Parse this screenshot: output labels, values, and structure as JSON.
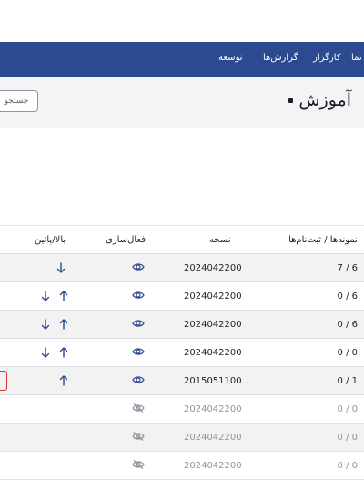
{
  "navbar": {
    "items": [
      {
        "label": "توسعه"
      },
      {
        "label": "گزارش‌ها"
      },
      {
        "label": "کارگزار"
      },
      {
        "label": "تما"
      }
    ],
    "background": "#2c4a8f"
  },
  "header": {
    "title": "آموزش",
    "search_label": "جستجو"
  },
  "table": {
    "headers": {
      "ratio": "نمونه‌ها / ثبت‌نام‌ها",
      "version": "نسخه",
      "enable": "فعال‌سازی",
      "order": "بالا/پائین"
    },
    "rows": [
      {
        "ratio": "7 / 6",
        "version": "2024042200",
        "visible": true,
        "up": false,
        "down": true,
        "edit": false
      },
      {
        "ratio": "0 / 6",
        "version": "2024042200",
        "visible": true,
        "up": true,
        "down": true,
        "edit": false
      },
      {
        "ratio": "0 / 6",
        "version": "2024042200",
        "visible": true,
        "up": true,
        "down": true,
        "edit": false
      },
      {
        "ratio": "0 / 0",
        "version": "2024042200",
        "visible": true,
        "up": true,
        "down": true,
        "edit": false
      },
      {
        "ratio": "0 / 1",
        "version": "2015051100",
        "visible": true,
        "up": true,
        "down": false,
        "edit": true
      },
      {
        "ratio": "0 / 0",
        "version": "2024042200",
        "visible": false,
        "up": false,
        "down": false,
        "edit": false
      },
      {
        "ratio": "0 / 0",
        "version": "2024042200",
        "visible": false,
        "up": false,
        "down": false,
        "edit": false
      },
      {
        "ratio": "0 / 0",
        "version": "2024042200",
        "visible": false,
        "up": false,
        "down": false,
        "edit": false
      }
    ]
  },
  "colors": {
    "accent": "#2c4a8f",
    "icon": "#2c4a8f",
    "muted": "#8f959e",
    "danger": "#dd3333"
  }
}
